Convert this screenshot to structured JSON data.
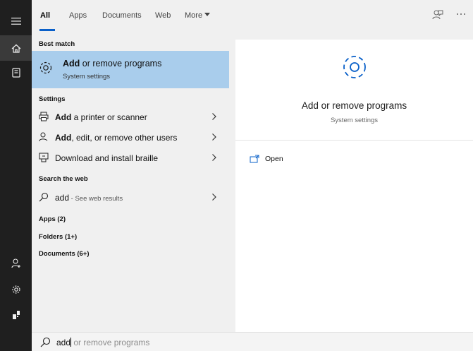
{
  "tabs": [
    {
      "label": "All"
    },
    {
      "label": "Apps"
    },
    {
      "label": "Documents"
    },
    {
      "label": "Web"
    },
    {
      "label": "More"
    }
  ],
  "sections": {
    "best_match": "Best match",
    "settings": "Settings",
    "search_web": "Search the web",
    "apps": "Apps (2)",
    "folders": "Folders (1+)",
    "documents": "Documents (6+)"
  },
  "best_match": {
    "title_bold": "Add",
    "title_rest": " or remove programs",
    "subtitle": "System settings"
  },
  "settings_items": [
    {
      "bold": "Add",
      "rest": " a printer or scanner",
      "icon": "printer-icon"
    },
    {
      "bold": "Add",
      "rest": ", edit, or remove other users",
      "icon": "person-icon"
    },
    {
      "bold": "",
      "rest": "Download and install braille",
      "icon": "braille-icon"
    }
  ],
  "web_result": {
    "query": "add",
    "hint": " - See web results"
  },
  "preview": {
    "title": "Add or remove programs",
    "subtitle": "System settings",
    "action": "Open"
  },
  "search": {
    "typed": "add",
    "suggestion": "or remove programs"
  },
  "colors": {
    "accent": "#0a60c9",
    "highlight": "#a9cdec",
    "rail": "#1f1f1f"
  }
}
